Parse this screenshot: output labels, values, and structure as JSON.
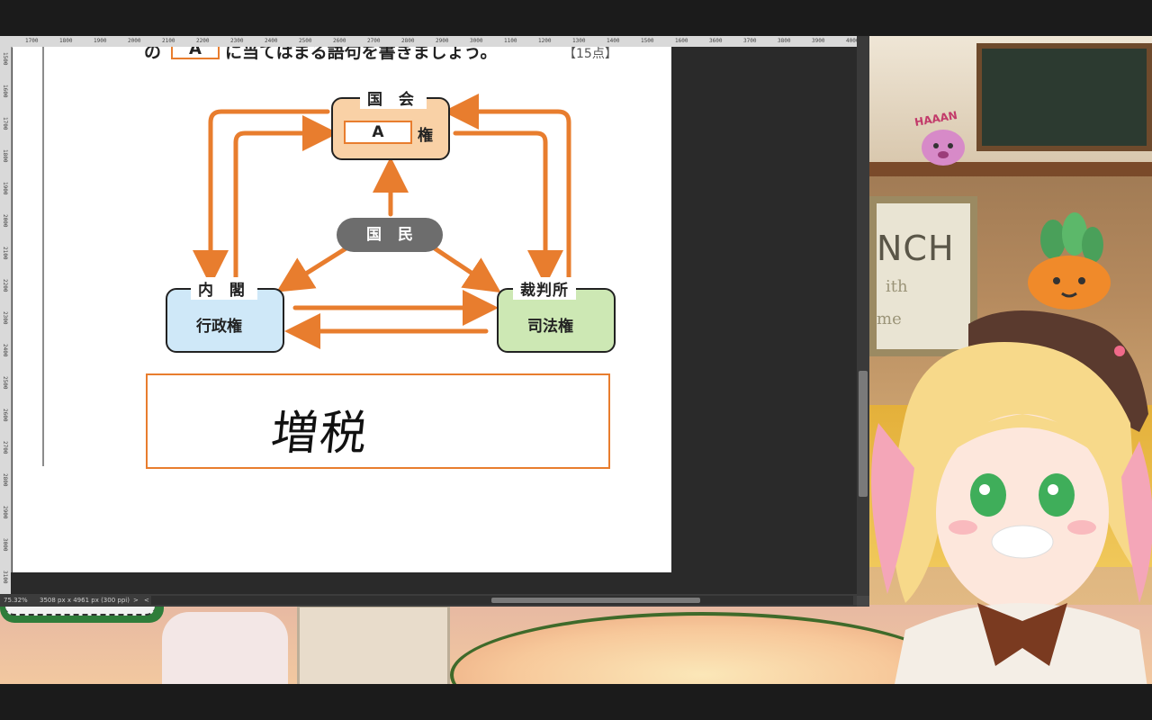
{
  "stream": {
    "poster_lines": [
      "NCH",
      "ith",
      "me"
    ],
    "plush_text": "HAAAN"
  },
  "editor": {
    "ruler_top_ticks": [
      "1700",
      "1800",
      "1900",
      "2000",
      "2100",
      "2200",
      "2300",
      "2400",
      "2500",
      "2600",
      "2700",
      "2800",
      "2900",
      "3000",
      "1100",
      "1200",
      "1300",
      "1400",
      "1500",
      "1600",
      "3600",
      "3700",
      "3800",
      "3900",
      "4000"
    ],
    "ruler_left_ticks": [
      "1500",
      "1600",
      "1700",
      "1800",
      "1900",
      "2000",
      "2100",
      "2200",
      "2300",
      "2400",
      "2500",
      "2600",
      "2700",
      "2800",
      "2900",
      "3000",
      "3100"
    ],
    "zoom": "75.32%",
    "doc_info": "3508 px x 4961 px (300 ppi)",
    "status_arrow": ">",
    "status_arrow2": "<"
  },
  "worksheet": {
    "question_prefix": "の",
    "question_box": "A",
    "question_rest": "に当てはまる語句を書きましょう。",
    "points": "【15点】",
    "diagram": {
      "kokkai_title": "国 会",
      "kokkai_answer": "A",
      "kokkai_power": "権",
      "kokumin": "国民",
      "naikaku_title": "内 閣",
      "naikaku_power": "行政権",
      "saiban_title": "裁判所",
      "saiban_power": "司法権"
    },
    "handwritten_answer": "増税"
  },
  "colors": {
    "arrow_orange": "#e87d2e",
    "kokkai_fill": "#f9d1a6",
    "naikaku_fill": "#cfe8f8",
    "saiban_fill": "#cde8b4",
    "kokumin_fill": "#6d6d6d"
  }
}
